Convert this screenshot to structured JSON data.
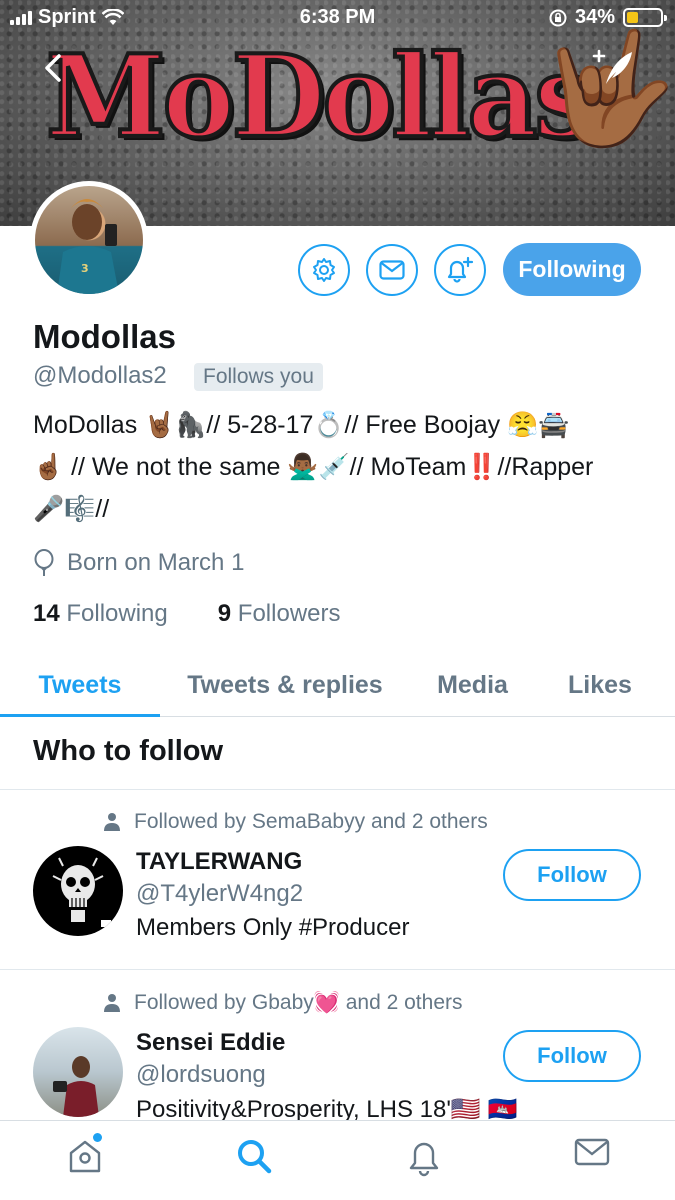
{
  "status_bar": {
    "carrier": "Sprint",
    "time": "6:38 PM",
    "battery_percent": "34%",
    "battery_level": 0.34
  },
  "banner": {
    "artwork_lettering": "MoDollas",
    "hand_emoji": "🤟🏾"
  },
  "icons": {
    "back": "chevron-left-icon",
    "compose": "compose-tweet-icon",
    "settings": "gear-icon",
    "message": "mail-icon",
    "notifications": "bell-plus-icon",
    "birthday": "balloon-icon",
    "social_context": "person-icon",
    "nav_home": "home-icon",
    "nav_search": "search-icon",
    "nav_notifications": "bell-icon",
    "nav_messages": "mail-icon"
  },
  "colors": {
    "accent": "#1da1f2",
    "following_button": "#4aa3ea",
    "secondary_text": "#657786",
    "banner_title": "#e23a4e",
    "battery": "#f5c518"
  },
  "profile": {
    "name": "Modollas",
    "handle": "@Modollas2",
    "follows_you": "Follows you",
    "bio_line1": "MoDollas 🤘🏾🦍// 5-28-17💍// Free Boojay 😤🚔",
    "bio_line2": "☝🏾 // We not the same 🙅🏾‍♂️💉// MoTeam‼️//Rapper",
    "bio_line3": "🎤🎼//",
    "birthday": "Born on March 1",
    "following_count": "14",
    "following_label": "Following",
    "followers_count": "9",
    "followers_label": "Followers",
    "following_button": "Following"
  },
  "tabs": [
    "Tweets",
    "Tweets & replies",
    "Media",
    "Likes"
  ],
  "who_to_follow": {
    "title": "Who to follow",
    "suggestions": [
      {
        "social_context": "Followed by SemaBabyy and 2 others",
        "name": "TAYLERWANG",
        "handle": "@T4ylerW4ng2",
        "bio": "Members Only #Producer",
        "button": "Follow"
      },
      {
        "social_context": "Followed by Gbaby💓 and 2 others",
        "name": "Sensei Eddie",
        "handle": "@lordsuong",
        "bio": "Positivity&Prosperity, LHS 18'🇺🇸 🇰🇭",
        "button": "Follow"
      }
    ]
  }
}
